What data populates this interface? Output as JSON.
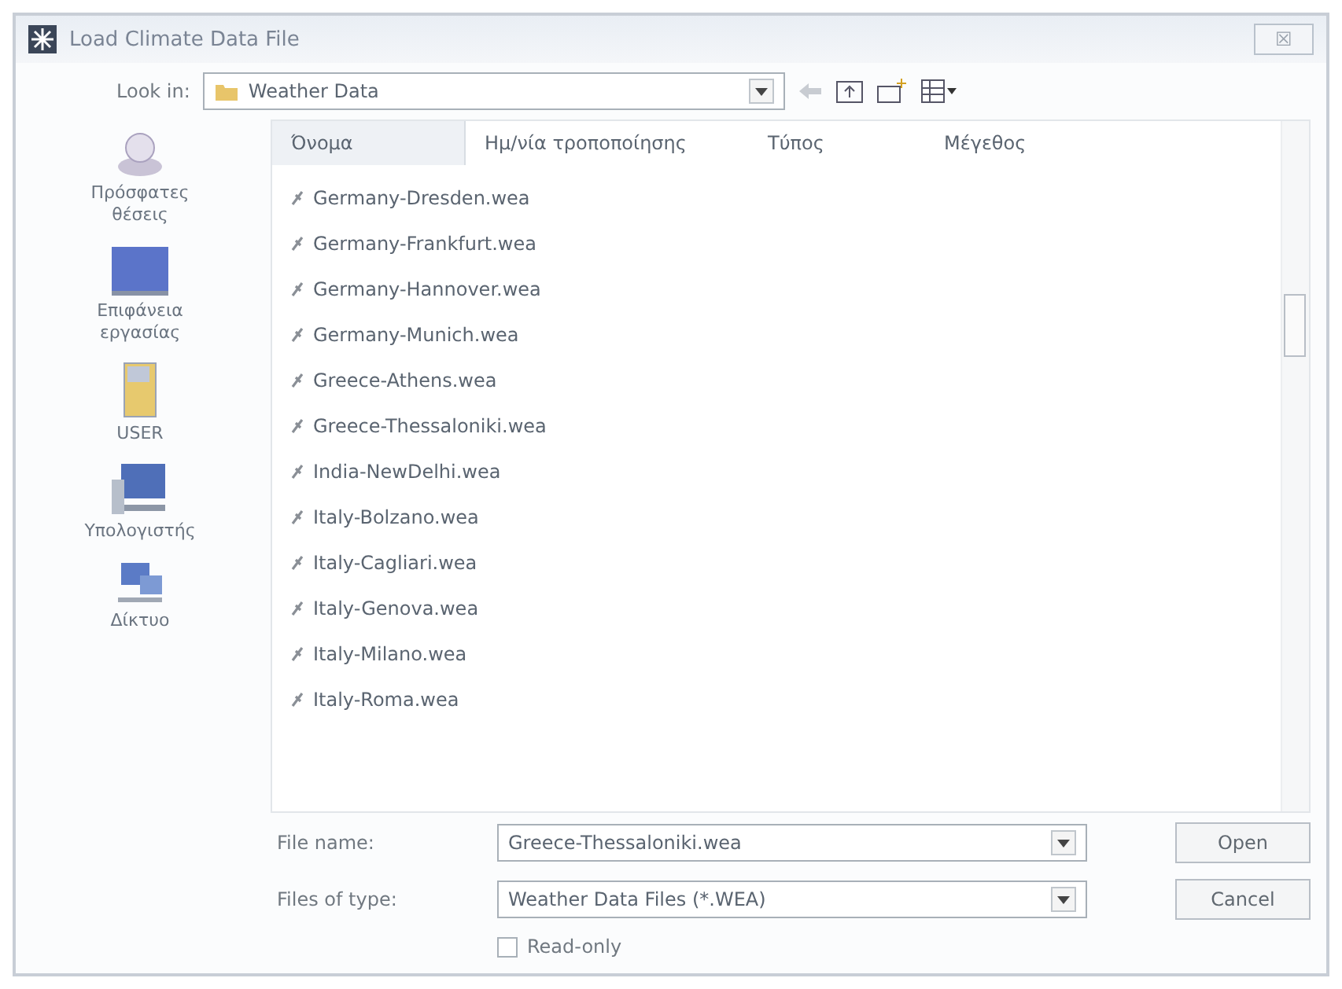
{
  "window": {
    "title": "Load Climate Data File",
    "close": "☒"
  },
  "look_in": {
    "label": "Look in:",
    "value": "Weather Data"
  },
  "places": [
    {
      "kind": "recent",
      "label": "Πρόσφατες θέσεις"
    },
    {
      "kind": "desktop",
      "label": "Επιφάνεια εργασίας"
    },
    {
      "kind": "user",
      "label": "USER"
    },
    {
      "kind": "computer",
      "label": "Υπολογιστής"
    },
    {
      "kind": "network",
      "label": "Δίκτυο"
    }
  ],
  "table": {
    "columns": [
      {
        "label": "Όνομα",
        "selected": true
      },
      {
        "label": "Ημ/νία τροποποίησης",
        "selected": false
      },
      {
        "label": "Τύπος",
        "selected": false
      },
      {
        "label": "Μέγεθος",
        "selected": false
      }
    ],
    "rows": [
      "Germany-Dresden.wea",
      "Germany-Frankfurt.wea",
      "Germany-Hannover.wea",
      "Germany-Munich.wea",
      "Greece-Athens.wea",
      "Greece-Thessaloniki.wea",
      "India-NewDelhi.wea",
      "Italy-Bolzano.wea",
      "Italy-Cagliari.wea",
      "Italy-Genova.wea",
      "Italy-Milano.wea",
      "Italy-Roma.wea"
    ]
  },
  "file_name": {
    "label": "File name:",
    "value": "Greece-Thessaloniki.wea"
  },
  "file_type": {
    "label": "Files of type:",
    "value": "Weather Data Files (*.WEA)"
  },
  "read_only": {
    "label": "Read-only",
    "checked": false
  },
  "buttons": [
    "Open",
    "Cancel"
  ]
}
